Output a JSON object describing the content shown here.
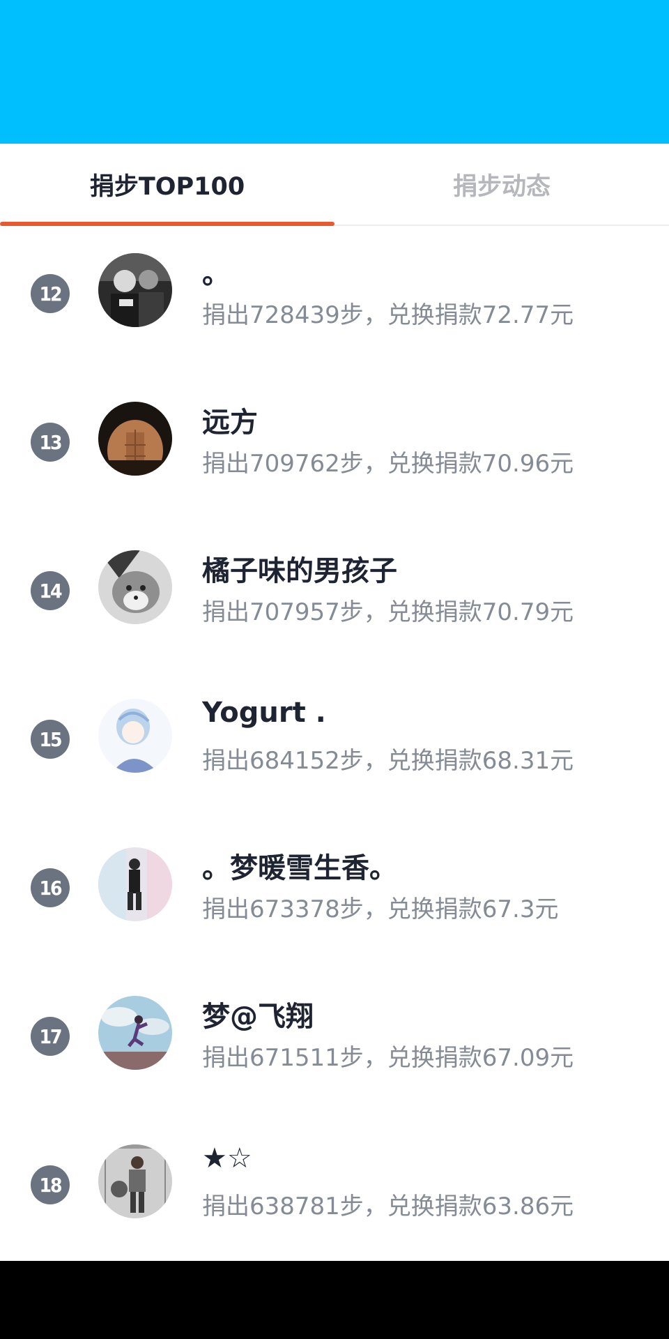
{
  "colors": {
    "banner": "#00BFFF",
    "active_tab_text": "#1F2433",
    "inactive_tab_text": "#B5B7BC",
    "tab_indicator": "#E85A2E",
    "rank_badge": "#6B7380",
    "name_text": "#1F2433",
    "summary_text": "#858B95"
  },
  "tabs": {
    "top100_label": "捐步TOP100",
    "activity_label": "捐步动态",
    "active": "top100"
  },
  "ranking": [
    {
      "rank": "12",
      "name": "。",
      "summary": "捐出728439步，兑换捐款72.77元"
    },
    {
      "rank": "13",
      "name": "远方",
      "summary": "捐出709762步，兑换捐款70.96元"
    },
    {
      "rank": "14",
      "name": "橘子味的男孩子",
      "summary": "捐出707957步，兑换捐款70.79元"
    },
    {
      "rank": "15",
      "name": "Yogurt .",
      "summary": "捐出684152步，兑换捐款68.31元"
    },
    {
      "rank": "16",
      "name": "。梦暖雪生香。",
      "summary": "捐出673378步，兑换捐款67.3元"
    },
    {
      "rank": "17",
      "name": "梦@飞翔",
      "summary": "捐出671511步，兑换捐款67.09元"
    },
    {
      "rank": "18",
      "name": "★☆",
      "summary": "捐出638781步，兑换捐款63.86元"
    }
  ]
}
